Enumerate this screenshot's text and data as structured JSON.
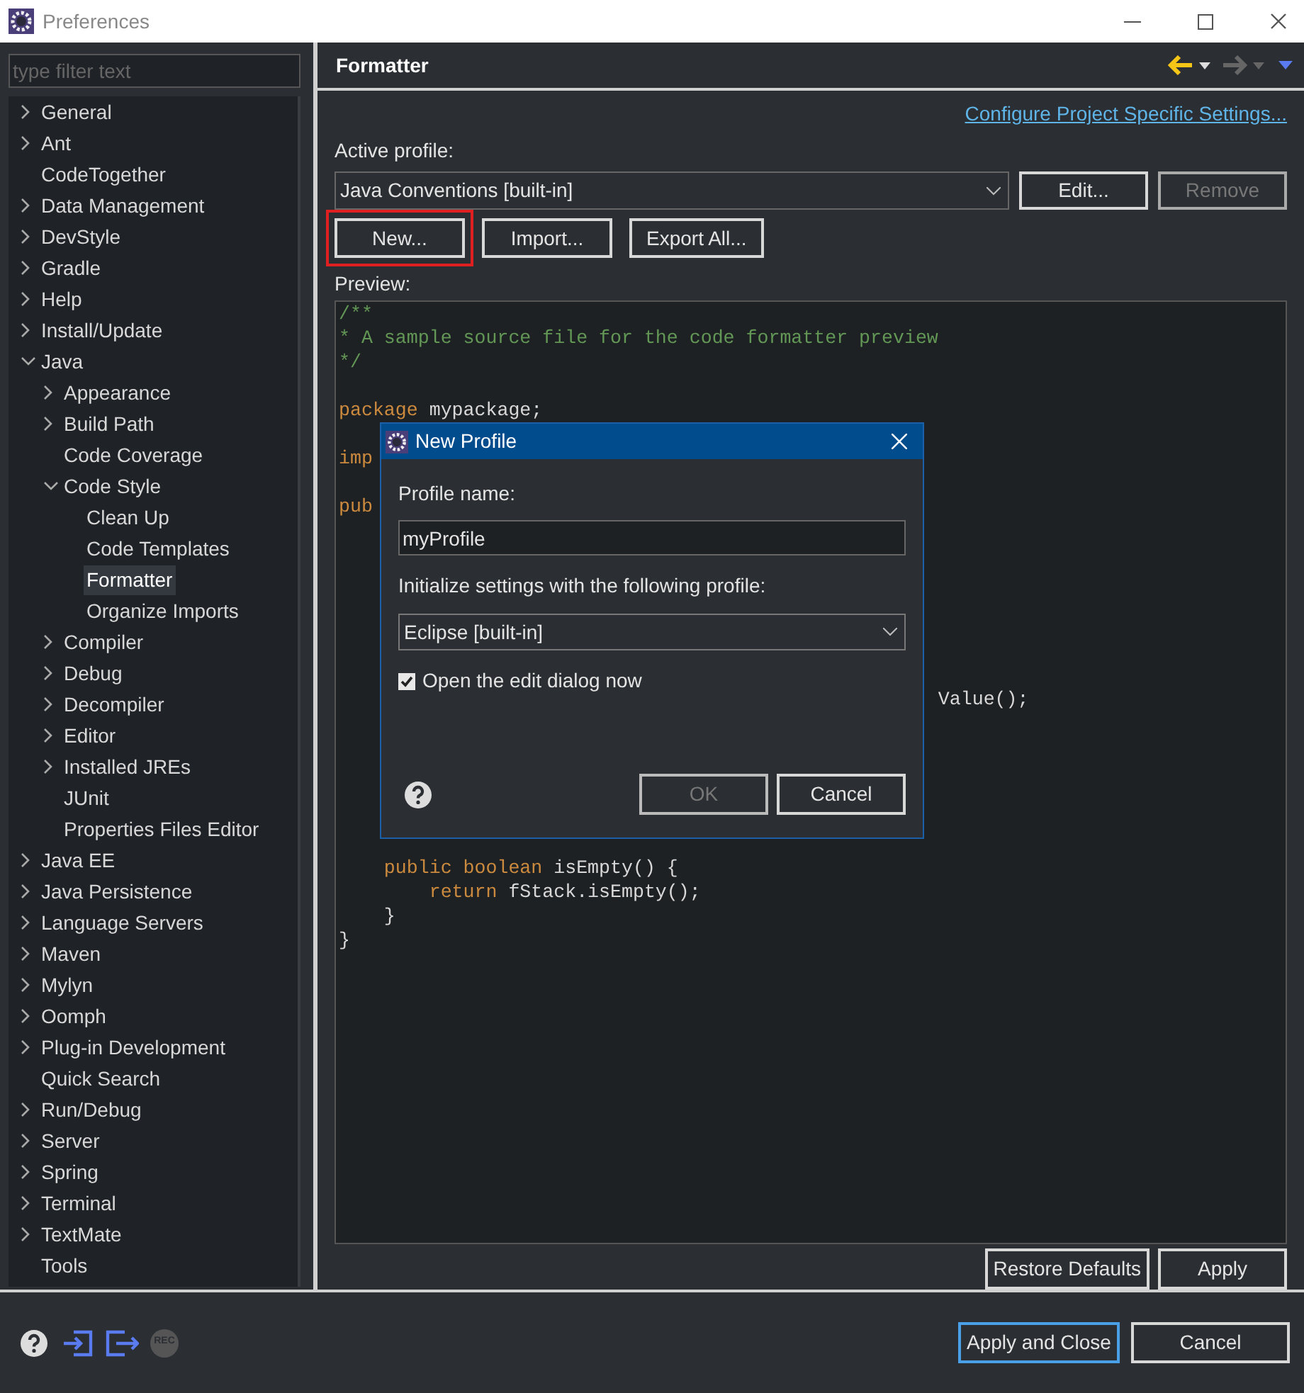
{
  "window": {
    "title": "Preferences"
  },
  "filter": {
    "placeholder": "type filter text"
  },
  "tree": [
    {
      "label": "General",
      "expanded": false,
      "selected": false
    },
    {
      "label": "Ant",
      "expanded": false,
      "selected": false
    },
    {
      "label": "CodeTogether",
      "selected": false
    },
    {
      "label": "Data Management",
      "expanded": false,
      "selected": false
    },
    {
      "label": "DevStyle",
      "expanded": false,
      "selected": false
    },
    {
      "label": "Gradle",
      "expanded": false,
      "selected": false
    },
    {
      "label": "Help",
      "expanded": false,
      "selected": false
    },
    {
      "label": "Install/Update",
      "expanded": false,
      "selected": false
    },
    {
      "label": "Java",
      "expanded": true,
      "selected": false,
      "children": [
        {
          "label": "Appearance",
          "expanded": false,
          "selected": false
        },
        {
          "label": "Build Path",
          "expanded": false,
          "selected": false
        },
        {
          "label": "Code Coverage",
          "selected": false
        },
        {
          "label": "Code Style",
          "expanded": true,
          "selected": false,
          "children": [
            {
              "label": "Clean Up",
              "selected": false
            },
            {
              "label": "Code Templates",
              "selected": false
            },
            {
              "label": "Formatter",
              "selected": true
            },
            {
              "label": "Organize Imports",
              "selected": false
            }
          ]
        },
        {
          "label": "Compiler",
          "expanded": false,
          "selected": false
        },
        {
          "label": "Debug",
          "expanded": false,
          "selected": false
        },
        {
          "label": "Decompiler",
          "expanded": false,
          "selected": false
        },
        {
          "label": "Editor",
          "expanded": false,
          "selected": false
        },
        {
          "label": "Installed JREs",
          "expanded": false,
          "selected": false
        },
        {
          "label": "JUnit",
          "selected": false
        },
        {
          "label": "Properties Files Editor",
          "selected": false
        }
      ]
    },
    {
      "label": "Java EE",
      "expanded": false,
      "selected": false
    },
    {
      "label": "Java Persistence",
      "expanded": false,
      "selected": false
    },
    {
      "label": "Language Servers",
      "expanded": false,
      "selected": false
    },
    {
      "label": "Maven",
      "expanded": false,
      "selected": false
    },
    {
      "label": "Mylyn",
      "expanded": false,
      "selected": false
    },
    {
      "label": "Oomph",
      "expanded": false,
      "selected": false
    },
    {
      "label": "Plug-in Development",
      "expanded": false,
      "selected": false
    },
    {
      "label": "Quick Search",
      "selected": false
    },
    {
      "label": "Run/Debug",
      "expanded": false,
      "selected": false
    },
    {
      "label": "Server",
      "expanded": false,
      "selected": false
    },
    {
      "label": "Spring",
      "expanded": false,
      "selected": false
    },
    {
      "label": "Terminal",
      "expanded": false,
      "selected": false
    },
    {
      "label": "TextMate",
      "expanded": false,
      "selected": false
    },
    {
      "label": "Tools",
      "selected": false
    }
  ],
  "page": {
    "title": "Formatter",
    "link": "Configure Project Specific Settings...",
    "active_profile_label": "Active profile:",
    "active_profile": "Java Conventions [built-in]",
    "profile_buttons": [
      {
        "label": "Edit...",
        "disabled": false
      },
      {
        "label": "Remove",
        "disabled": true
      }
    ],
    "action_buttons": [
      {
        "label": "New...",
        "highlighted": true
      },
      {
        "label": "Import...",
        "highlighted": false
      },
      {
        "label": "Export All...",
        "highlighted": false
      }
    ],
    "preview_label": "Preview:",
    "code": [
      {
        "kind": "text",
        "segments": [
          {
            "kind": "comment",
            "text": "/**"
          }
        ]
      },
      {
        "kind": "text",
        "segments": [
          {
            "kind": "comment",
            "text": "* A sample source file for the code formatter preview"
          }
        ]
      },
      {
        "kind": "text",
        "segments": [
          {
            "kind": "comment",
            "text": "*/"
          }
        ]
      },
      {
        "kind": "blank"
      },
      {
        "kind": "text",
        "segments": [
          {
            "kind": "keyword",
            "text": "package"
          },
          {
            "kind": "plain",
            "text": " mypackage;"
          }
        ]
      },
      {
        "kind": "blank"
      },
      {
        "kind": "text",
        "segments": [
          {
            "kind": "keyword",
            "text": "imp"
          }
        ]
      },
      {
        "kind": "blank"
      },
      {
        "kind": "text",
        "segments": [
          {
            "kind": "keyword",
            "text": "pub"
          }
        ]
      },
      {
        "kind": "blank"
      },
      {
        "kind": "blank"
      },
      {
        "kind": "blank"
      },
      {
        "kind": "blank"
      },
      {
        "kind": "blank"
      },
      {
        "kind": "blank"
      },
      {
        "kind": "blank"
      },
      {
        "kind": "text",
        "segments": [
          {
            "kind": "plain",
            "text": "                                                     Value();"
          }
        ]
      },
      {
        "kind": "blank"
      },
      {
        "kind": "blank"
      },
      {
        "kind": "blank"
      },
      {
        "kind": "blank"
      },
      {
        "kind": "blank"
      },
      {
        "kind": "blank"
      },
      {
        "kind": "text",
        "segments": [
          {
            "kind": "keyword",
            "text": "    public boolean"
          },
          {
            "kind": "plain",
            "text": " isEmpty() {"
          }
        ]
      },
      {
        "kind": "text",
        "segments": [
          {
            "kind": "keyword",
            "text": "        return"
          },
          {
            "kind": "plain",
            "text": " fStack.isEmpty();"
          }
        ]
      },
      {
        "kind": "text",
        "segments": [
          {
            "kind": "plain",
            "text": "    }"
          }
        ]
      },
      {
        "kind": "text",
        "segments": [
          {
            "kind": "plain",
            "text": "}"
          }
        ]
      }
    ],
    "bottom_buttons": [
      {
        "label": "Restore Defaults"
      },
      {
        "label": "Apply"
      }
    ]
  },
  "dialog": {
    "title": "New Profile",
    "name_label": "Profile name:",
    "name_value": "myProfile",
    "init_label": "Initialize settings with the following profile:",
    "init_value": "Eclipse [built-in]",
    "open_edit": {
      "label": "Open the edit dialog now",
      "checked": true
    },
    "buttons": [
      {
        "label": "OK",
        "disabled": true
      },
      {
        "label": "Cancel",
        "disabled": false
      }
    ]
  },
  "footer": {
    "record_label": "REC",
    "buttons": [
      {
        "label": "Apply and Close",
        "default": true
      },
      {
        "label": "Cancel",
        "default": false
      }
    ]
  }
}
